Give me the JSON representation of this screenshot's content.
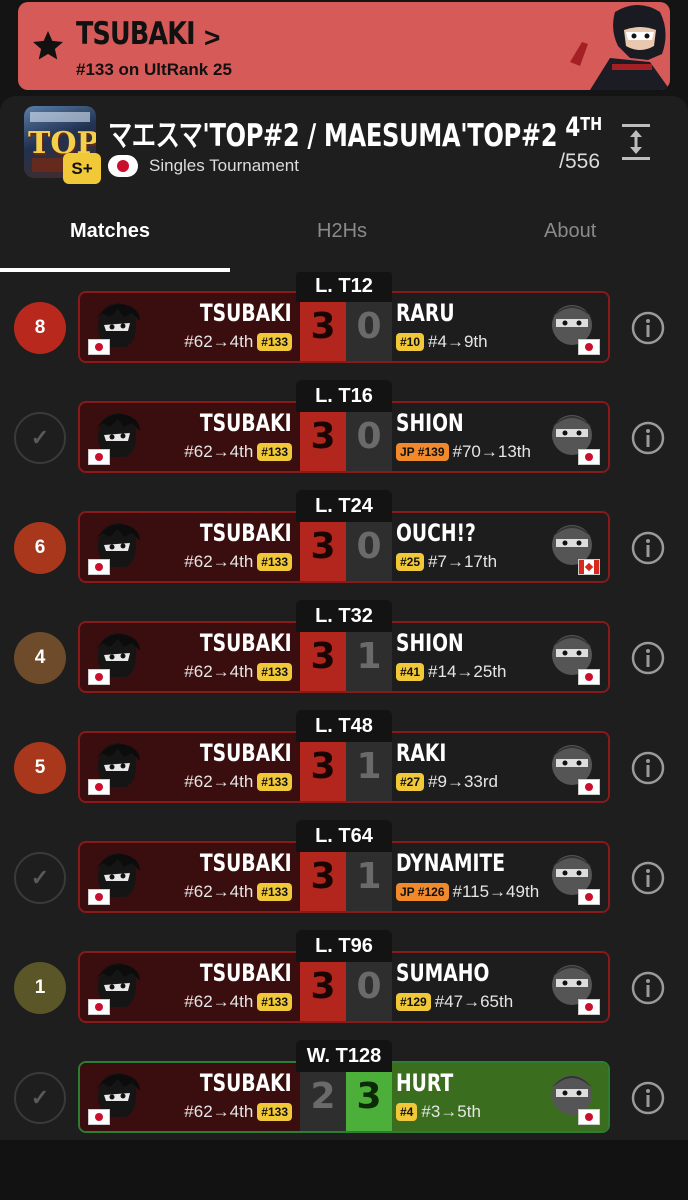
{
  "banner": {
    "player": "TSUBAKI",
    "chevron": ">",
    "rank_text": "#133 on UltRank 25",
    "color": "#d65b58"
  },
  "tournament": {
    "logo_text": "TOP",
    "tier": "S+",
    "title": "マエスマ'TOP#2 / MAESUMA'TOP#2",
    "type": "Singles Tournament",
    "place_num": "4",
    "place_suffix": "TH",
    "total": "/556"
  },
  "tabs": [
    {
      "label": "Matches",
      "active": true
    },
    {
      "label": "H2Hs",
      "active": false
    },
    {
      "label": "About",
      "active": false
    }
  ],
  "matches": [
    {
      "round": "L. T12",
      "indicator": "8",
      "indicator_color": "#b8281c",
      "p1": "TSUBAKI",
      "p1_seed": "#62→4th",
      "p1_rank": "#133",
      "s1": "3",
      "s2": "0",
      "p2": "RARU",
      "p2_rank": "#10",
      "p2_rank_type": "world",
      "p2_seed": "#4→9th",
      "p2_flag": "jp",
      "won": false
    },
    {
      "round": "L. T16",
      "indicator": "✓",
      "indicator_color": "",
      "p1": "TSUBAKI",
      "p1_seed": "#62→4th",
      "p1_rank": "#133",
      "s1": "3",
      "s2": "0",
      "p2": "SHION",
      "p2_rank": "JP #139",
      "p2_rank_type": "jp",
      "p2_seed": "#70→13th",
      "p2_flag": "jp",
      "won": false
    },
    {
      "round": "L. T24",
      "indicator": "6",
      "indicator_color": "#a8371c",
      "p1": "TSUBAKI",
      "p1_seed": "#62→4th",
      "p1_rank": "#133",
      "s1": "3",
      "s2": "0",
      "p2": "OUCH!?",
      "p2_rank": "#25",
      "p2_rank_type": "world",
      "p2_seed": "#7→17th",
      "p2_flag": "ca",
      "won": false
    },
    {
      "round": "L. T32",
      "indicator": "4",
      "indicator_color": "#6e4b2a",
      "p1": "TSUBAKI",
      "p1_seed": "#62→4th",
      "p1_rank": "#133",
      "s1": "3",
      "s2": "1",
      "p2": "SHION",
      "p2_rank": "#41",
      "p2_rank_type": "world",
      "p2_seed": "#14→25th",
      "p2_flag": "jp",
      "won": false
    },
    {
      "round": "L. T48",
      "indicator": "5",
      "indicator_color": "#a8371c",
      "p1": "TSUBAKI",
      "p1_seed": "#62→4th",
      "p1_rank": "#133",
      "s1": "3",
      "s2": "1",
      "p2": "RAKI",
      "p2_rank": "#27",
      "p2_rank_type": "world",
      "p2_seed": "#9→33rd",
      "p2_flag": "jp",
      "won": false
    },
    {
      "round": "L. T64",
      "indicator": "✓",
      "indicator_color": "",
      "p1": "TSUBAKI",
      "p1_seed": "#62→4th",
      "p1_rank": "#133",
      "s1": "3",
      "s2": "1",
      "p2": "DYNAMITE",
      "p2_rank": "JP #126",
      "p2_rank_type": "jp",
      "p2_seed": "#115→49th",
      "p2_flag": "jp",
      "won": false
    },
    {
      "round": "L. T96",
      "indicator": "1",
      "indicator_color": "#5a5628",
      "p1": "TSUBAKI",
      "p1_seed": "#62→4th",
      "p1_rank": "#133",
      "s1": "3",
      "s2": "0",
      "p2": "SUMAHO",
      "p2_rank": "#129",
      "p2_rank_type": "world",
      "p2_seed": "#47→65th",
      "p2_flag": "jp",
      "won": false
    },
    {
      "round": "W. T128",
      "indicator": "✓",
      "indicator_color": "",
      "p1": "TSUBAKI",
      "p1_seed": "#62→4th",
      "p1_rank": "#133",
      "s1": "2",
      "s2": "3",
      "p2": "HURT",
      "p2_rank": "#4",
      "p2_rank_type": "world",
      "p2_seed": "#3→5th",
      "p2_flag": "jp",
      "won": true
    }
  ]
}
